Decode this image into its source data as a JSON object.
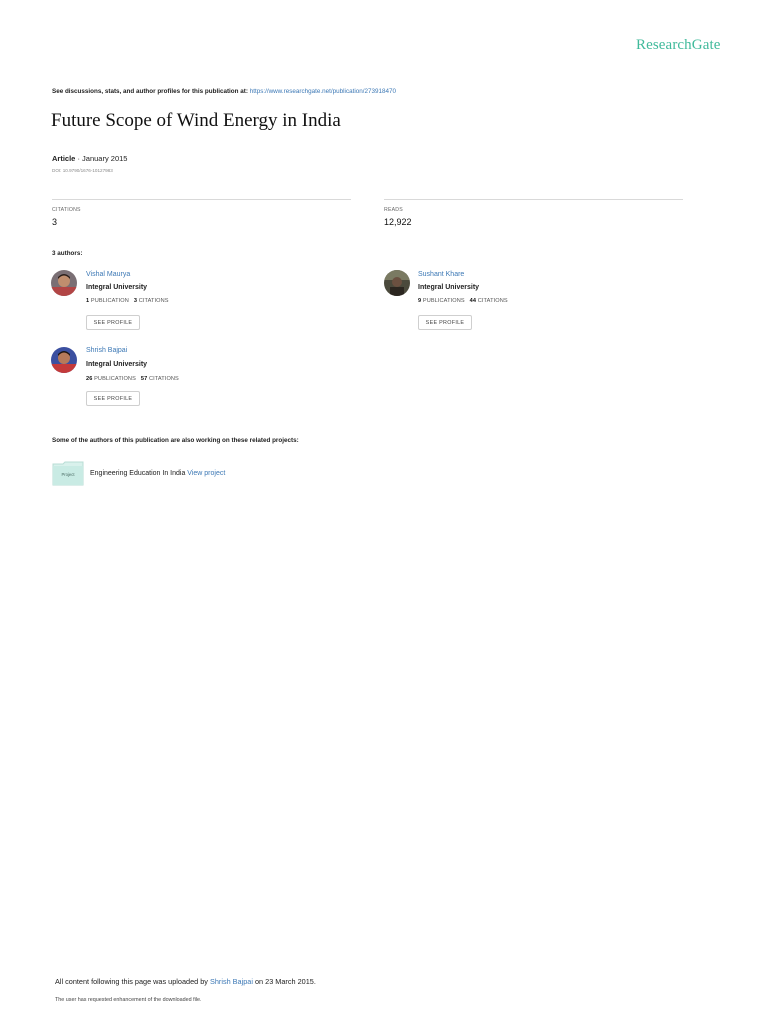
{
  "header": {
    "brand": "ResearchGate",
    "discussion_prefix": "See discussions, stats, and author profiles for this publication at: ",
    "publication_url": "https://www.researchgate.net/publication/273918470"
  },
  "publication": {
    "title": "Future Scope of Wind Energy in India",
    "type": "Article",
    "date": "· January 2015",
    "doi": "DOI: 10.9790/1676-10127983"
  },
  "stats": {
    "citations_label": "CITATIONS",
    "citations_value": "3",
    "reads_label": "READS",
    "reads_value": "12,922"
  },
  "authors_heading": "3 authors:",
  "authors": [
    {
      "name": "Vishal Maurya",
      "institution": "Integral University",
      "publications_count": "1",
      "publications_label": "PUBLICATION",
      "citations_count": "3",
      "citations_label": "CITATIONS",
      "button_label": "SEE PROFILE"
    },
    {
      "name": "Sushant Khare",
      "institution": "Integral University",
      "publications_count": "9",
      "publications_label": "PUBLICATIONS",
      "citations_count": "44",
      "citations_label": "CITATIONS",
      "button_label": "SEE PROFILE"
    },
    {
      "name": "Shrish Bajpai",
      "institution": "Integral University",
      "publications_count": "26",
      "publications_label": "PUBLICATIONS",
      "citations_count": "57",
      "citations_label": "CITATIONS",
      "button_label": "SEE PROFILE"
    }
  ],
  "related": {
    "heading": "Some of the authors of this publication are also working on these related projects:",
    "project_icon_label": "Project",
    "project_name": "Engineering Education In India ",
    "project_link": "View project"
  },
  "footer": {
    "upload_prefix": "All content following this page was uploaded by ",
    "uploader": "Shrish Bajpai",
    "upload_suffix": " on 23 March 2015.",
    "note": "The user has requested enhancement of the downloaded file."
  },
  "colors": {
    "brand": "#40ba9b",
    "link": "#3c78b5"
  }
}
